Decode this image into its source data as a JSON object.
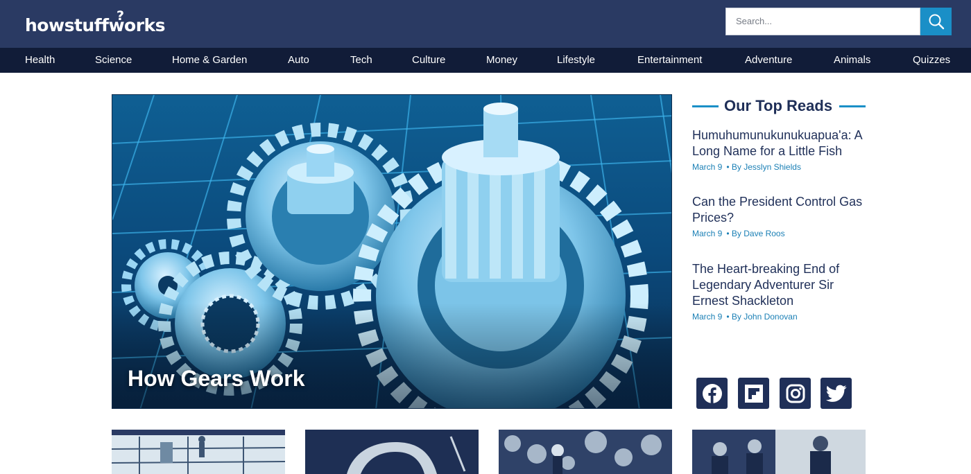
{
  "header": {
    "logo": {
      "text": "howstuffworks",
      "mark": "?"
    },
    "search": {
      "placeholder": "Search..."
    },
    "search_icon": "magnifier-icon"
  },
  "nav": {
    "items": [
      {
        "label": "Health"
      },
      {
        "label": "Science"
      },
      {
        "label": "Home & Garden"
      },
      {
        "label": "Auto"
      },
      {
        "label": "Tech"
      },
      {
        "label": "Culture"
      },
      {
        "label": "Money"
      },
      {
        "label": "Lifestyle"
      },
      {
        "label": "Entertainment"
      },
      {
        "label": "Adventure"
      },
      {
        "label": "Animals"
      },
      {
        "label": "Quizzes"
      }
    ]
  },
  "hero": {
    "title": "How Gears Work"
  },
  "top_reads": {
    "heading": "Our Top Reads",
    "articles": [
      {
        "title": "Humuhumunukunukuapua'a: A Long Name for a Little Fish",
        "date": "March 9",
        "byline": "• By Jesslyn Shields"
      },
      {
        "title": "Can the President Control Gas Prices?",
        "date": "March 9",
        "byline": "• By Dave Roos"
      },
      {
        "title": "The Heart-breaking End of Legendary Adventurer Sir Ernest Shackleton",
        "date": "March 9",
        "byline": "• By John Donovan"
      }
    ]
  },
  "social": {
    "icons": [
      "facebook-icon",
      "flipboard-icon",
      "instagram-icon",
      "twitter-icon"
    ]
  },
  "colors": {
    "header_bg": "#2a3a63",
    "nav_bg": "#111c38",
    "accent": "#1a8fc7",
    "heading_text": "#1f2f58",
    "meta_text": "#1a7fb5"
  }
}
